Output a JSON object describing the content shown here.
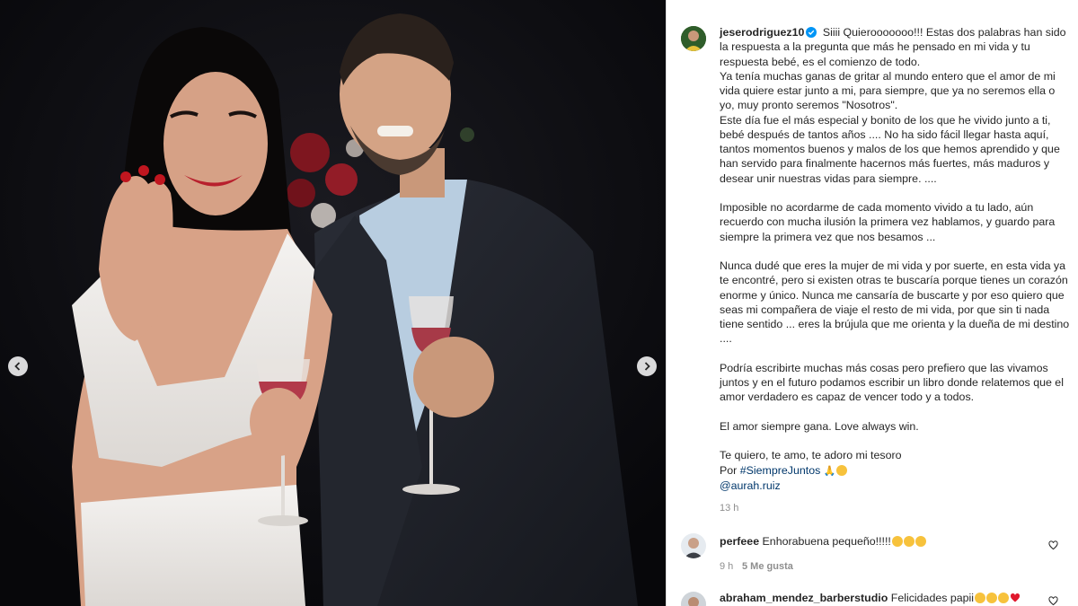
{
  "post": {
    "username": "jeserodriguez10",
    "caption": {
      "p1": "Siiii Quierooooooo!!! Estas dos palabras han sido la respuesta a la pregunta que más he pensado en mi vida y tu respuesta bebé, es el comienzo de todo.",
      "p2": "Ya tenía muchas ganas de gritar al mundo entero que el amor de mi vida quiere estar junto a mi, para siempre, que ya no seremos ella o yo, muy pronto seremos \"Nosotros\".",
      "p3": "Este día fue el más especial y bonito de los que he vivido junto a ti, bebé después de tantos años .... No ha sido fácil llegar hasta aquí, tantos momentos buenos y malos de los que hemos aprendido y que han servido para finalmente hacernos más fuertes, más maduros y desear unir nuestras vidas para siempre. ....",
      "p4": "Imposible no acordarme de cada momento vivido a tu lado, aún recuerdo con mucha ilusión la primera vez hablamos, y guardo para siempre la primera vez que nos besamos ...",
      "p5": "Nunca dudé que eres la mujer de mi vida y por suerte, en esta vida ya te encontré, pero si existen otras te buscaría porque tienes un corazón enorme y único. Nunca me cansaría de buscarte y por eso quiero que seas mi compañera de viaje el resto de mi vida, por que sin ti nada tiene sentido ... eres la brújula que me orienta y la dueña de mi destino ....",
      "p6": "Podría escribirte muchas más cosas pero prefiero que las vivamos juntos y en el futuro podamos escribir un libro donde relatemos que el amor verdadero es capaz de vencer todo y a todos.",
      "p7": "El amor siempre gana. Love always win.",
      "p8": "Te quiero, te amo, te adoro mi tesoro",
      "p9_prefix": "Por",
      "hashtag": "#SiempreJuntos",
      "mention": "@aurah.ruiz"
    },
    "time": "13 h"
  },
  "comments": [
    {
      "username": "perfeee",
      "text": "Enhorabuena pequeño!!!!!",
      "time": "9 h",
      "likes": "5 Me gusta"
    },
    {
      "username": "abraham_mendez_barberstudio",
      "text": "Felicidades papii"
    }
  ],
  "icons": {
    "prev": "chevron-left-icon",
    "next": "chevron-right-icon",
    "like": "heart-icon",
    "verified": "verified-badge-icon"
  },
  "colors": {
    "verified": "#0095f6",
    "link": "#00376b",
    "meta": "#8e8e8e"
  }
}
